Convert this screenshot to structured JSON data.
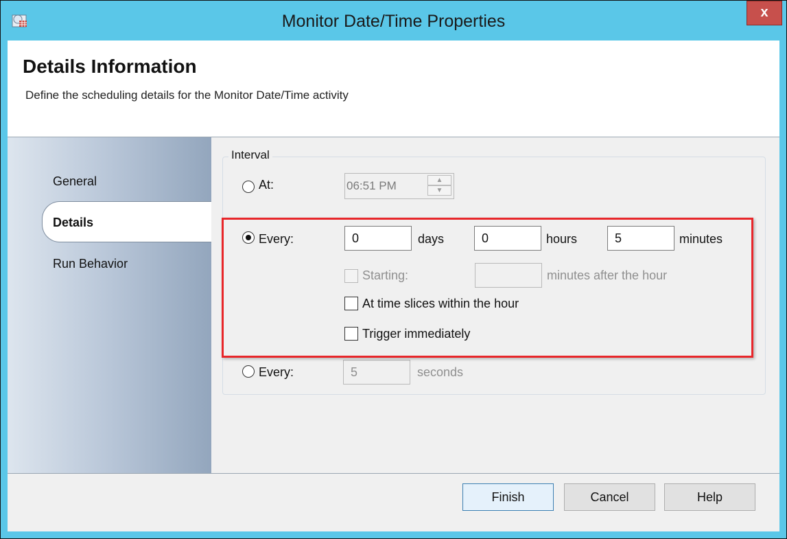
{
  "window": {
    "title": "Monitor Date/Time Properties",
    "close_label": "x"
  },
  "header": {
    "title": "Details Information",
    "subtitle": "Define the scheduling details for the Monitor Date/Time activity"
  },
  "sidebar": {
    "items": [
      {
        "label": "General",
        "selected": false
      },
      {
        "label": "Details",
        "selected": true
      },
      {
        "label": "Run Behavior",
        "selected": false
      }
    ]
  },
  "interval": {
    "legend": "Interval",
    "at": {
      "label": "At:",
      "selected": false,
      "time_value": "06:51 PM"
    },
    "every_time": {
      "label": "Every:",
      "selected": true,
      "days": {
        "value": "0",
        "unit": "days"
      },
      "hours": {
        "value": "0",
        "unit": "hours"
      },
      "minutes": {
        "value": "5",
        "unit": "minutes"
      },
      "starting": {
        "label": "Starting:",
        "checked": false,
        "enabled": false,
        "value": "",
        "suffix": "minutes after the hour"
      },
      "time_slices": {
        "label": "At time slices within the hour",
        "checked": false
      },
      "trigger": {
        "label": "Trigger immediately",
        "checked": false
      }
    },
    "every_seconds": {
      "label": "Every:",
      "selected": false,
      "value": "5",
      "unit": "seconds"
    }
  },
  "buttons": {
    "finish": "Finish",
    "cancel": "Cancel",
    "help": "Help"
  },
  "colors": {
    "titlebar": "#5ac7e8",
    "close": "#c7504c",
    "highlight": "#e8262a"
  }
}
